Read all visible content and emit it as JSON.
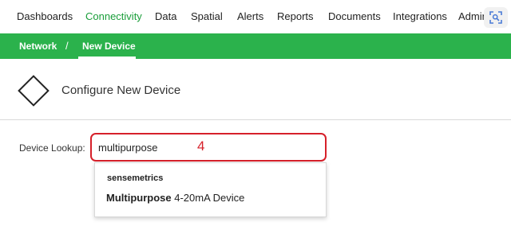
{
  "topnav": {
    "items": [
      {
        "label": "Dashboards",
        "active": false
      },
      {
        "label": "Connectivity",
        "active": true
      },
      {
        "label": "Data",
        "active": false
      },
      {
        "label": "Spatial",
        "active": false
      },
      {
        "label": "Alerts",
        "active": false
      },
      {
        "label": "Reports",
        "active": false
      },
      {
        "label": "Documents",
        "active": false
      },
      {
        "label": "Integrations",
        "active": false
      },
      {
        "label": "Admin",
        "active": false
      }
    ],
    "screenshot_icon": "screenshot-icon"
  },
  "breadcrumb": {
    "items": [
      {
        "label": "Network"
      },
      {
        "label": "New Device"
      }
    ],
    "separator": "/"
  },
  "header": {
    "icon": "diamond-icon",
    "title": "Configure New Device"
  },
  "lookup": {
    "label": "Device Lookup:",
    "value": "multipurpose",
    "annotation": "4"
  },
  "dropdown": {
    "group_label": "sensemetrics",
    "options": [
      {
        "match": "Multipurpose",
        "rest": " 4-20mA Device"
      }
    ]
  },
  "colors": {
    "brand_green": "#2bb24c",
    "active_nav": "#1a9e3a",
    "highlight_red": "#d6202a"
  }
}
